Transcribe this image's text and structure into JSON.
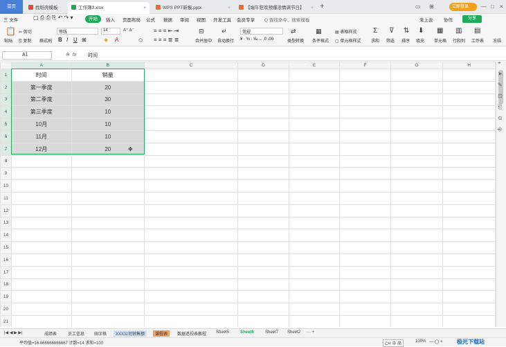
{
  "tabs": {
    "home": "首页",
    "t1": "找稻壳模板",
    "t2": "工作簿3.xlsx",
    "t3": "WPS PPT新报.pptx",
    "t4": "【端午狂欢预爆浓情满节日】"
  },
  "login_label": "立即登录",
  "menu": {
    "file": "三 文件",
    "start": "开始",
    "insert": "插入",
    "layout": "页面布局",
    "formula": "公式",
    "data": "数据",
    "review": "审阅",
    "view": "视图",
    "dev": "开发工具",
    "vip": "会员专享",
    "search": "Q 查找命令、搜索模板",
    "cloud": "未上云",
    "collab": "协作",
    "share": "分享"
  },
  "ribbon": {
    "paste": "粘贴",
    "cut": "剪切",
    "copy": "复制",
    "format_painter": "格式刷",
    "font": "等线",
    "size": "14",
    "merge": "合并居中",
    "wrap": "自动换行",
    "numfmt": "常规",
    "type_convert": "类型转换",
    "cond_fmt": "条件格式",
    "table_style": "表格样式",
    "cell_style": "单元格样式",
    "sum": "求和",
    "filter": "筛选",
    "sort": "排序",
    "fill": "填充",
    "cells": "单元格",
    "rowcol": "行和列",
    "sheet": "工作表",
    "freeze": "冻结"
  },
  "formula_bar": {
    "cell_ref": "A1",
    "fx": "fx",
    "value": "时间"
  },
  "columns": [
    "A",
    "B",
    "C",
    "D",
    "E",
    "F",
    "G",
    "H"
  ],
  "rows": [
    [
      "时间",
      "销量"
    ],
    [
      "第一季度",
      "20"
    ],
    [
      "第二季度",
      "30"
    ],
    [
      "第三季度",
      "10"
    ],
    [
      "10月",
      "10"
    ],
    [
      "11月",
      "10"
    ],
    [
      "12月",
      "20"
    ],
    [
      "",
      ""
    ],
    [
      "",
      ""
    ],
    [
      "",
      ""
    ],
    [
      "",
      ""
    ],
    [
      "",
      ""
    ],
    [
      "",
      ""
    ],
    [
      "",
      ""
    ],
    [
      "",
      ""
    ],
    [
      "",
      ""
    ],
    [
      "",
      ""
    ],
    [
      "",
      ""
    ],
    [
      "",
      ""
    ],
    [
      "",
      ""
    ],
    [
      "",
      ""
    ]
  ],
  "sheet_tabs": [
    "成绩表",
    "员工信息",
    "田字格",
    "XXX公司销售额",
    "课程表",
    "数据透视表教程",
    "Sheet5",
    "Sheet6",
    "Sheet7",
    "Sheet2"
  ],
  "status": {
    "stats": "平均值=16.666666666667  计数=14  求和=100",
    "ime": "CH 中 简",
    "zoom": "100%"
  },
  "watermark": "极光下载站"
}
